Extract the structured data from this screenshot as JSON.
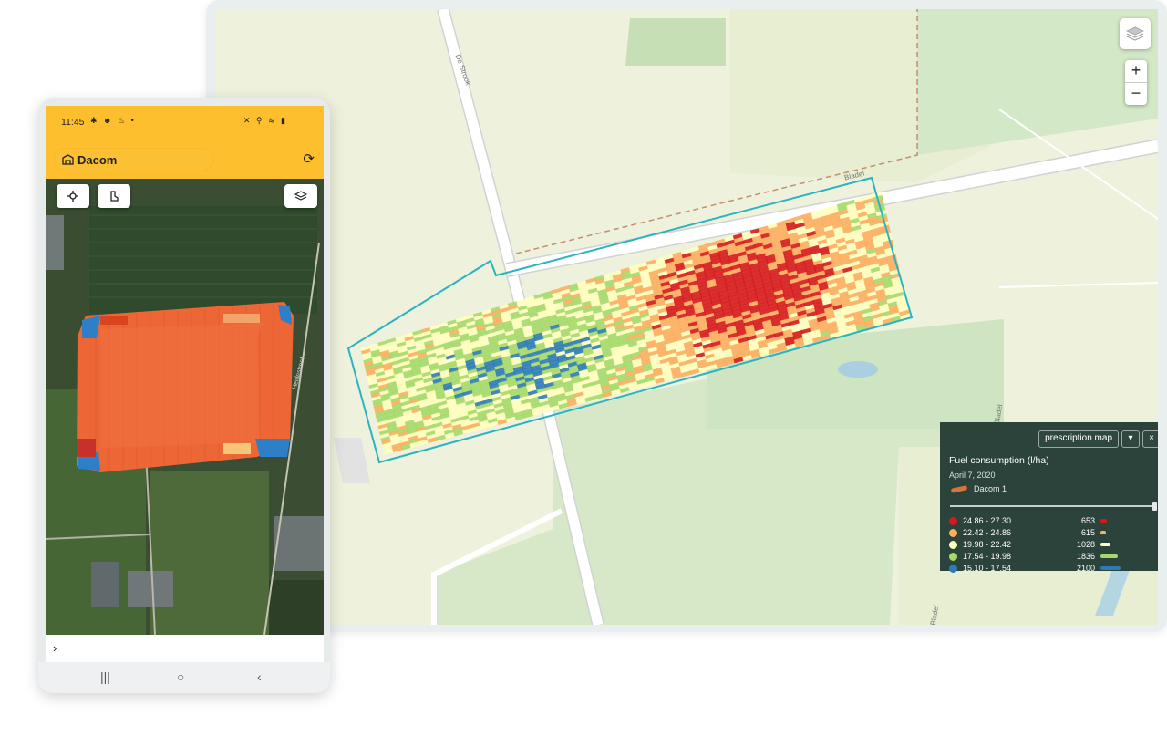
{
  "map": {
    "road_de_strook": "De Strook",
    "road_bladel_top": "Bladel",
    "road_bladel_right": "Bladel",
    "road_bladel_bottom": "Bladel",
    "zoom_in": "+",
    "zoom_out": "−",
    "layers_icon": "layers-icon"
  },
  "legend": {
    "layer_select": "prescription map",
    "dropdown": "▾",
    "close": "×",
    "title": "Fuel consumption (l/ha)",
    "date": "April 7, 2020",
    "machine": "Dacom 1",
    "slider_value": 1.0,
    "classes": [
      {
        "range": "24.86 - 27.30",
        "count": "653",
        "color": "#d7191c",
        "count_value": 653
      },
      {
        "range": "22.42 - 24.86",
        "count": "615",
        "color": "#fdae61",
        "count_value": 615
      },
      {
        "range": "19.98 - 22.42",
        "count": "1028",
        "color": "#ffffbf",
        "count_value": 1028
      },
      {
        "range": "17.54 - 19.98",
        "count": "1836",
        "color": "#a6d96a",
        "count_value": 1836
      },
      {
        "range": "15.10 - 17.54",
        "count": "2100",
        "color": "#2c7bb6",
        "count_value": 2100
      }
    ]
  },
  "phone": {
    "time": "11:45",
    "status_left_icons": "✱ ☻ ♨ •",
    "status_right_icons": "✕ ⚲ ≋ ▮",
    "farm_name": "Dacom",
    "street_name": "Heidestreef",
    "bottom_chevron": "›",
    "nav_recent": "|||",
    "nav_home": "○",
    "nav_back": "‹"
  }
}
